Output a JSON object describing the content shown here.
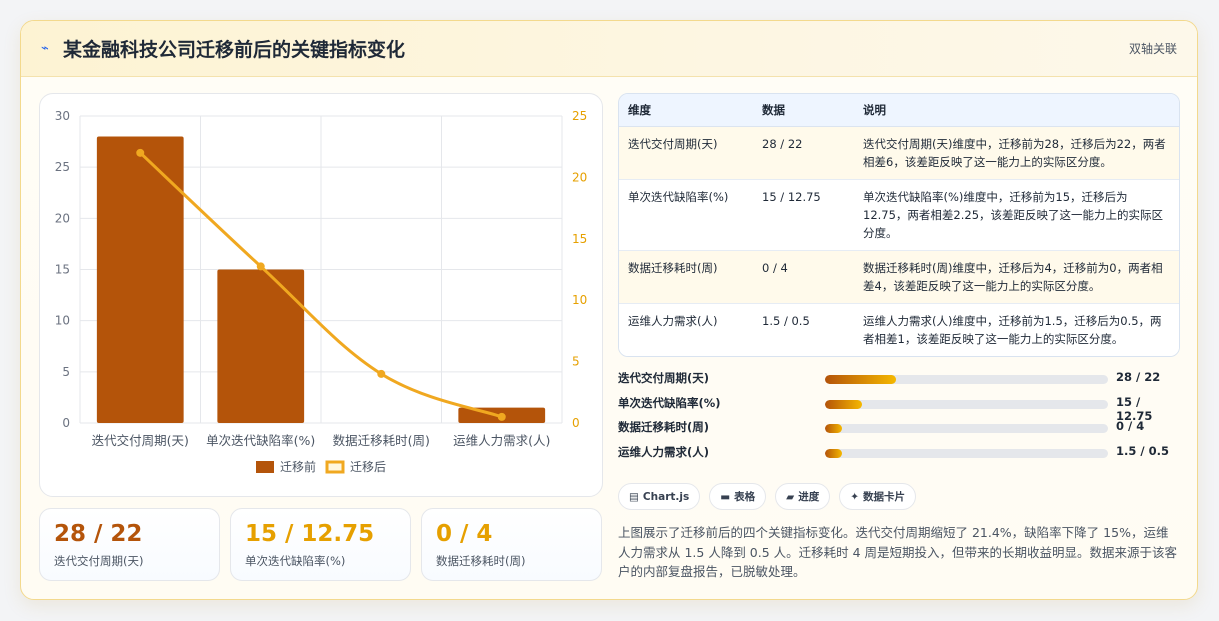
{
  "header": {
    "icon": "chart-line-icon",
    "title": "某金融科技公司迁移前后的关键指标变化",
    "badge": "双轴关联"
  },
  "chart_data": {
    "type": "bar",
    "categories": [
      "迭代交付周期(天)",
      "单次迭代缺陷率(%)",
      "数据迁移耗时(周)",
      "运维人力需求(人)"
    ],
    "series": [
      {
        "name": "迁移前",
        "type": "bar",
        "axis": "left",
        "color": "#b4540a",
        "values": [
          28,
          15,
          0,
          1.5
        ]
      },
      {
        "name": "迁移后",
        "type": "line",
        "axis": "right",
        "color": "#f0a820",
        "values": [
          22,
          12.75,
          4,
          0.5
        ]
      }
    ],
    "y_left": {
      "min": 0,
      "max": 30,
      "ticks": [
        0,
        5,
        10,
        15,
        20,
        25,
        30
      ]
    },
    "y_right": {
      "min": 0,
      "max": 25,
      "ticks": [
        0,
        5,
        10,
        15,
        20,
        25
      ]
    },
    "grid": true,
    "legend_position": "bottom"
  },
  "kpis": [
    {
      "value": "28 / 22",
      "label": "迭代交付周期(天)",
      "color": "#b4540a"
    },
    {
      "value": "15 / 12.75",
      "label": "单次迭代缺陷率(%)",
      "color": "#e6a000"
    },
    {
      "value": "0 / 4",
      "label": "数据迁移耗时(周)",
      "color": "#e6a000"
    }
  ],
  "table": {
    "headers": [
      "维度",
      "数据",
      "说明"
    ],
    "rows": [
      [
        "迭代交付周期(天)",
        "28 / 22",
        "迭代交付周期(天)维度中，迁移前为28，迁移后为22，两者相差6，该差距反映了这一能力上的实际区分度。"
      ],
      [
        "单次迭代缺陷率(%)",
        "15 / 12.75",
        "单次迭代缺陷率(%)维度中，迁移前为15，迁移后为12.75，两者相差2.25，该差距反映了这一能力上的实际区分度。"
      ],
      [
        "数据迁移耗时(周)",
        "0 / 4",
        "数据迁移耗时(周)维度中，迁移后为4，迁移前为0，两者相差4，该差距反映了这一能力上的实际区分度。"
      ],
      [
        "运维人力需求(人)",
        "1.5 / 0.5",
        "运维人力需求(人)维度中，迁移前为1.5，迁移后为0.5，两者相差1，该差距反映了这一能力上的实际区分度。"
      ]
    ]
  },
  "progress": [
    {
      "label": "迭代交付周期(天)",
      "value": "28 / 22",
      "fraction": 0.25
    },
    {
      "label": "单次迭代缺陷率(%)",
      "value": "15 / 12.75",
      "fraction": 0.13
    },
    {
      "label": "数据迁移耗时(周)",
      "value": "0 / 4",
      "fraction": 0.06
    },
    {
      "label": "运维人力需求(人)",
      "value": "1.5 / 0.5",
      "fraction": 0.06
    }
  ],
  "chips": [
    {
      "icon": "chart-icon",
      "glyph": "▤",
      "label": "Chart.js"
    },
    {
      "icon": "table-icon",
      "glyph": "▬",
      "label": "表格"
    },
    {
      "icon": "progress-icon",
      "glyph": "▰",
      "label": "进度"
    },
    {
      "icon": "card-icon",
      "glyph": "✦",
      "label": "数据卡片"
    }
  ],
  "note": "上图展示了迁移前后的四个关键指标变化。迭代交付周期缩短了 21.4%，缺陷率下降了 15%，运维人力需求从 1.5 人降到 0.5 人。迁移耗时 4 周是短期投入，但带来的长期收益明显。数据来源于该客户的内部复盘报告，已脱敏处理。"
}
